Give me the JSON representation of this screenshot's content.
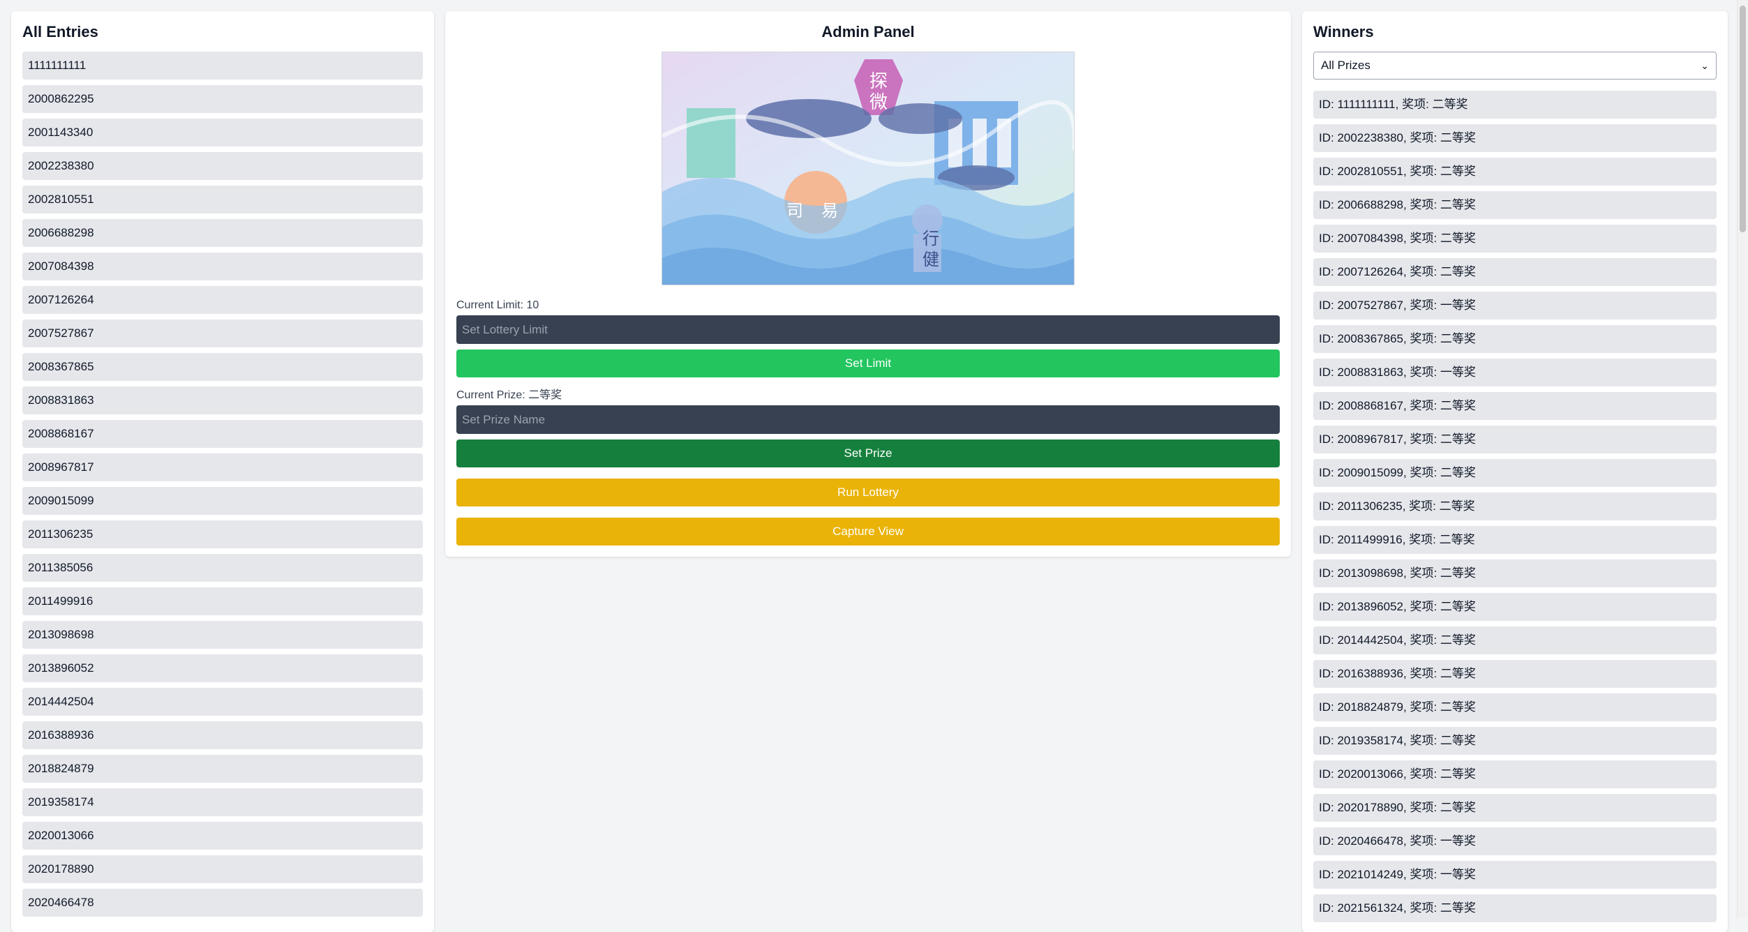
{
  "left": {
    "title": "All Entries",
    "entries": [
      "1111111111",
      "2000862295",
      "2001143340",
      "2002238380",
      "2002810551",
      "2006688298",
      "2007084398",
      "2007126264",
      "2007527867",
      "2008367865",
      "2008831863",
      "2008868167",
      "2008967817",
      "2009015099",
      "2011306235",
      "2011385056",
      "2011499916",
      "2013098698",
      "2013896052",
      "2014442504",
      "2016388936",
      "2018824879",
      "2019358174",
      "2020013066",
      "2020178890",
      "2020466478"
    ]
  },
  "center": {
    "title": "Admin Panel",
    "limit_label": "Current Limit: 10",
    "limit_placeholder": "Set Lottery Limit",
    "set_limit_label": "Set Limit",
    "prize_label": "Current Prize: 二等奖",
    "prize_placeholder": "Set Prize Name",
    "set_prize_label": "Set Prize",
    "run_lottery_label": "Run Lottery",
    "capture_view_label": "Capture View",
    "banner_text": [
      "探",
      "微",
      "行",
      "健",
      "司",
      "易"
    ]
  },
  "right": {
    "title": "Winners",
    "filter_value": "All Prizes",
    "winners": [
      "ID: 1111111111, 奖项: 二等奖",
      "ID: 2002238380, 奖项: 二等奖",
      "ID: 2002810551, 奖项: 二等奖",
      "ID: 2006688298, 奖项: 二等奖",
      "ID: 2007084398, 奖项: 二等奖",
      "ID: 2007126264, 奖项: 二等奖",
      "ID: 2007527867, 奖项: 一等奖",
      "ID: 2008367865, 奖项: 二等奖",
      "ID: 2008831863, 奖项: 一等奖",
      "ID: 2008868167, 奖项: 二等奖",
      "ID: 2008967817, 奖项: 二等奖",
      "ID: 2009015099, 奖项: 二等奖",
      "ID: 2011306235, 奖项: 二等奖",
      "ID: 2011499916, 奖项: 二等奖",
      "ID: 2013098698, 奖项: 二等奖",
      "ID: 2013896052, 奖项: 二等奖",
      "ID: 2014442504, 奖项: 二等奖",
      "ID: 2016388936, 奖项: 二等奖",
      "ID: 2018824879, 奖项: 二等奖",
      "ID: 2019358174, 奖项: 二等奖",
      "ID: 2020013066, 奖项: 二等奖",
      "ID: 2020178890, 奖项: 二等奖",
      "ID: 2020466478, 奖项: 一等奖",
      "ID: 2021014249, 奖项: 一等奖",
      "ID: 2021561324, 奖项: 二等奖"
    ]
  },
  "colors": {
    "page_bg": "#f3f4f6",
    "input_bg": "#374151",
    "set_limit": "#22c55e",
    "set_prize": "#15803d",
    "run_lottery": "#eab308",
    "capture_view": "#eab308"
  },
  "icons": {
    "select_arrow": "chevron-down-icon"
  }
}
